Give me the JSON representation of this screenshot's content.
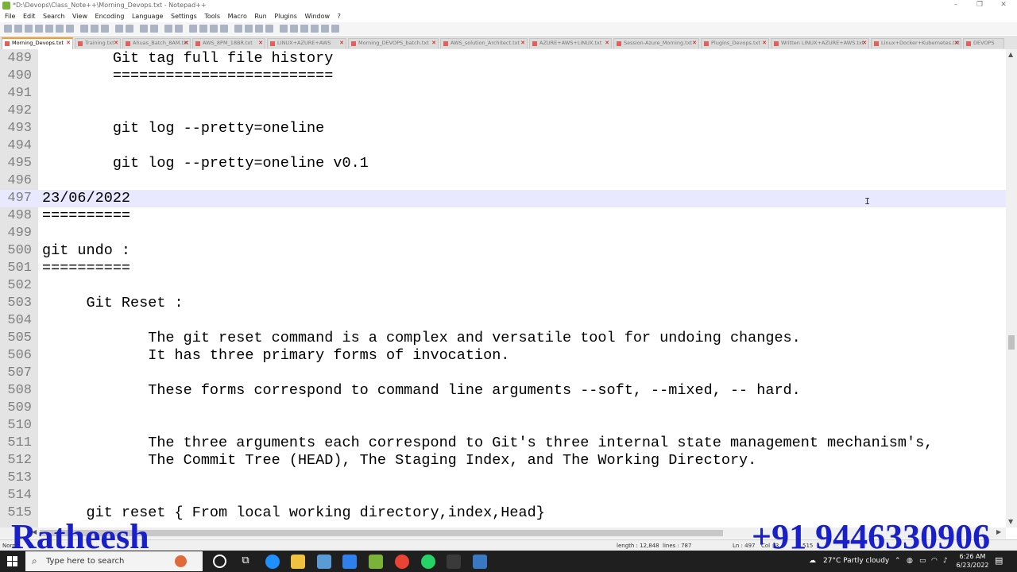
{
  "window": {
    "title": "*D:\\Devops\\Class_Note++\\Morning_Devops.txt - Notepad++",
    "controls": [
      "–",
      "❐",
      "✕"
    ]
  },
  "menu": [
    "File",
    "Edit",
    "Search",
    "View",
    "Encoding",
    "Language",
    "Settings",
    "Tools",
    "Macro",
    "Run",
    "Plugins",
    "Window",
    "?"
  ],
  "tabs": [
    {
      "label": "Morning_Devops.txt",
      "active": true
    },
    {
      "label": "Training.txt",
      "active": false
    },
    {
      "label": "Ahuas_Batch_8AM.txt",
      "active": false
    },
    {
      "label": "AWS_8PM_18BR.txt",
      "active": false
    },
    {
      "label": "LINUX+AZURE+AWS",
      "active": false
    },
    {
      "label": "Morning_DEVOPS_batch.txt",
      "active": false
    },
    {
      "label": "AWS_solution_Architect.txt",
      "active": false
    },
    {
      "label": "AZURE+AWS+LINUX.txt",
      "active": false
    },
    {
      "label": "Session-Azure_Morning.txt",
      "active": false
    },
    {
      "label": "Plugins_Devops.txt",
      "active": false
    },
    {
      "label": "Written LINUX+AZURE+AWS.txt",
      "active": false
    },
    {
      "label": "Linux+Docker+Kubernetes.txt",
      "active": false
    },
    {
      "label": "DEVOPS",
      "active": false
    }
  ],
  "editor": {
    "current_line": 497,
    "lines": [
      {
        "n": "489",
        "text": "        Git tag full file history"
      },
      {
        "n": "490",
        "text": "        ========================="
      },
      {
        "n": "491",
        "text": ""
      },
      {
        "n": "492",
        "text": ""
      },
      {
        "n": "493",
        "text": "        git log --pretty=oneline"
      },
      {
        "n": "494",
        "text": ""
      },
      {
        "n": "495",
        "text": "        git log --pretty=oneline v0.1"
      },
      {
        "n": "496",
        "text": ""
      },
      {
        "n": "497",
        "text": "23/06/2022"
      },
      {
        "n": "498",
        "text": "=========="
      },
      {
        "n": "499",
        "text": ""
      },
      {
        "n": "500",
        "text": "git undo :"
      },
      {
        "n": "501",
        "text": "=========="
      },
      {
        "n": "502",
        "text": ""
      },
      {
        "n": "503",
        "text": "     Git Reset :"
      },
      {
        "n": "504",
        "text": ""
      },
      {
        "n": "505",
        "text": "            The git reset command is a complex and versatile tool for undoing changes."
      },
      {
        "n": "506",
        "text": "            It has three primary forms of invocation."
      },
      {
        "n": "507",
        "text": ""
      },
      {
        "n": "508",
        "text": "            These forms correspond to command line arguments --soft, --mixed, -- hard."
      },
      {
        "n": "509",
        "text": ""
      },
      {
        "n": "510",
        "text": ""
      },
      {
        "n": "511",
        "text": "            The three arguments each correspond to Git's three internal state management mechanism's,"
      },
      {
        "n": "512",
        "text": "            The Commit Tree (HEAD), The Staging Index, and The Working Directory."
      },
      {
        "n": "513",
        "text": ""
      },
      {
        "n": "514",
        "text": ""
      },
      {
        "n": "515",
        "text": "     git reset { From local working directory,index,Head}"
      }
    ]
  },
  "status": {
    "left": "Norm",
    "length": "length : 12,848",
    "lines": "lines : 787",
    "ln": "Ln : 497",
    "col": "Col : 3",
    "pos": "515"
  },
  "taskbar": {
    "search_placeholder": "Type here to search",
    "weather": "27°C  Partly cloudy",
    "time": "6:26 AM",
    "date": "6/23/2022"
  },
  "overlay": {
    "name": "Ratheesh",
    "phone": "+91 9446330906"
  }
}
